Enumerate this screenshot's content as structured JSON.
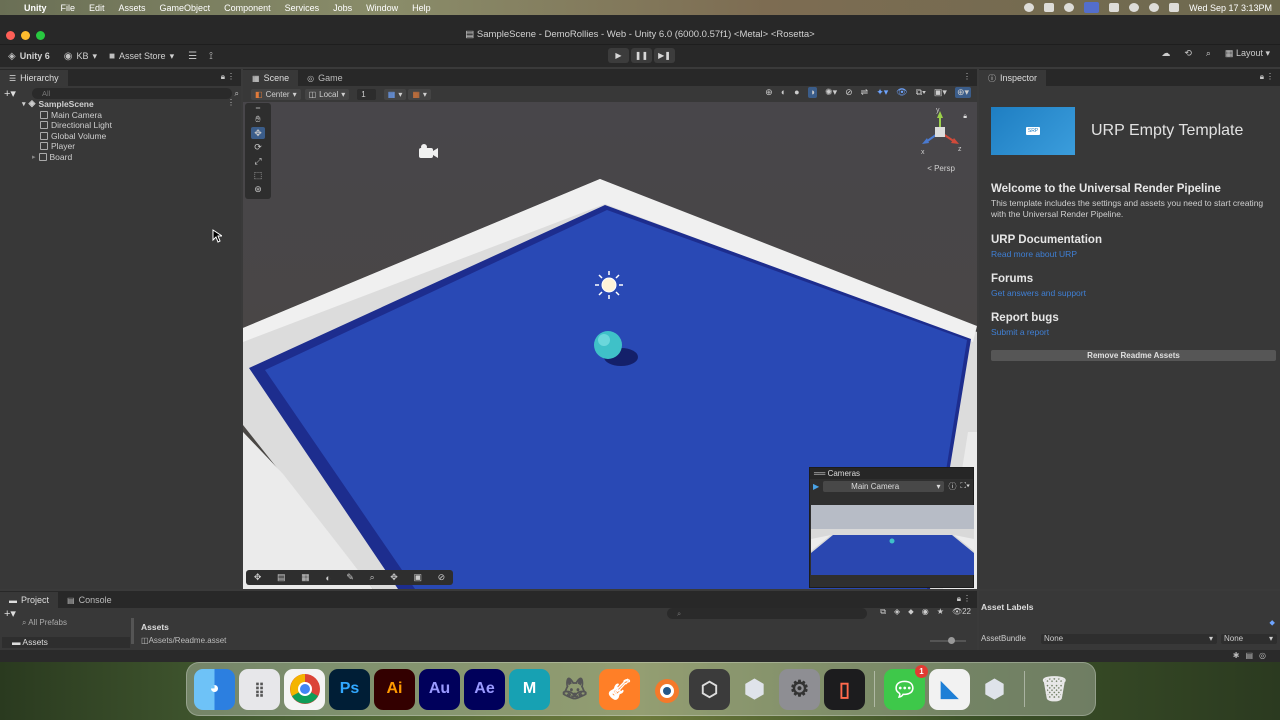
{
  "menubar": {
    "apple": "",
    "app": "Unity",
    "items": [
      "File",
      "Edit",
      "Assets",
      "GameObject",
      "Component",
      "Services",
      "Jobs",
      "Window",
      "Help"
    ],
    "datetime": "Wed Sep 17  3:13PM"
  },
  "window": {
    "title": "SampleScene - DemoRollies - Web - Unity 6.0 (6000.0.57f1) <Metal> <Rosetta>"
  },
  "toolbar": {
    "unity_account": "Unity 6",
    "user": "KB",
    "asset_store": "Asset Store",
    "layout": "Layout"
  },
  "hierarchy": {
    "tab": "Hierarchy",
    "search_placeholder": "All",
    "scene": "SampleScene",
    "items": [
      "Main Camera",
      "Directional Light",
      "Global Volume",
      "Player",
      "Board"
    ]
  },
  "scene_view": {
    "tabs": [
      "Scene",
      "Game"
    ],
    "pivot": "Center",
    "space": "Local",
    "snap_value": "1",
    "persp_label": "< Persp",
    "gizmo_y": "y",
    "gizmo_x": "x",
    "gizmo_z": "z"
  },
  "cameras_overlay": {
    "title": "Cameras",
    "selected": "Main Camera"
  },
  "inspector": {
    "tab": "Inspector",
    "badge": "SRP",
    "title": "URP Empty Template",
    "welcome_heading": "Welcome to the Universal Render Pipeline",
    "welcome_text": "This template includes the settings and assets you need to start creating with the Universal Render Pipeline.",
    "doc_heading": "URP Documentation",
    "doc_link": "Read more about URP",
    "forums_heading": "Forums",
    "forums_link": "Get answers and support",
    "bugs_heading": "Report bugs",
    "bugs_link": "Submit a report",
    "remove_button": "Remove Readme Assets"
  },
  "project": {
    "tabs": [
      "Project",
      "Console"
    ],
    "tree_items": [
      "All Prefabs",
      "Assets"
    ],
    "breadcrumb": "Assets",
    "file": "Assets/Readme.asset",
    "count": "22"
  },
  "asset_labels": {
    "title": "Asset Labels",
    "assetbundle_label": "AssetBundle",
    "assetbundle_value": "None",
    "variant_value": "None"
  },
  "dock": {
    "apps": [
      "finder-icon",
      "launchpad-icon",
      "chrome-icon",
      "photoshop-icon",
      "illustrator-icon",
      "audition-icon",
      "after-effects-icon",
      "maya-icon",
      "gimp-icon",
      "garageband-icon",
      "blender-icon",
      "unity-hub-icon",
      "unity-6-icon",
      "system-settings-icon",
      "simulator-icon",
      "messages-icon",
      "vscode-icon",
      "unity-6-icon-2",
      "trash-icon"
    ],
    "ps": "Ps",
    "ai": "Ai",
    "au": "Au",
    "ae": "Ae",
    "maya": "M",
    "messages_badge": "1"
  }
}
